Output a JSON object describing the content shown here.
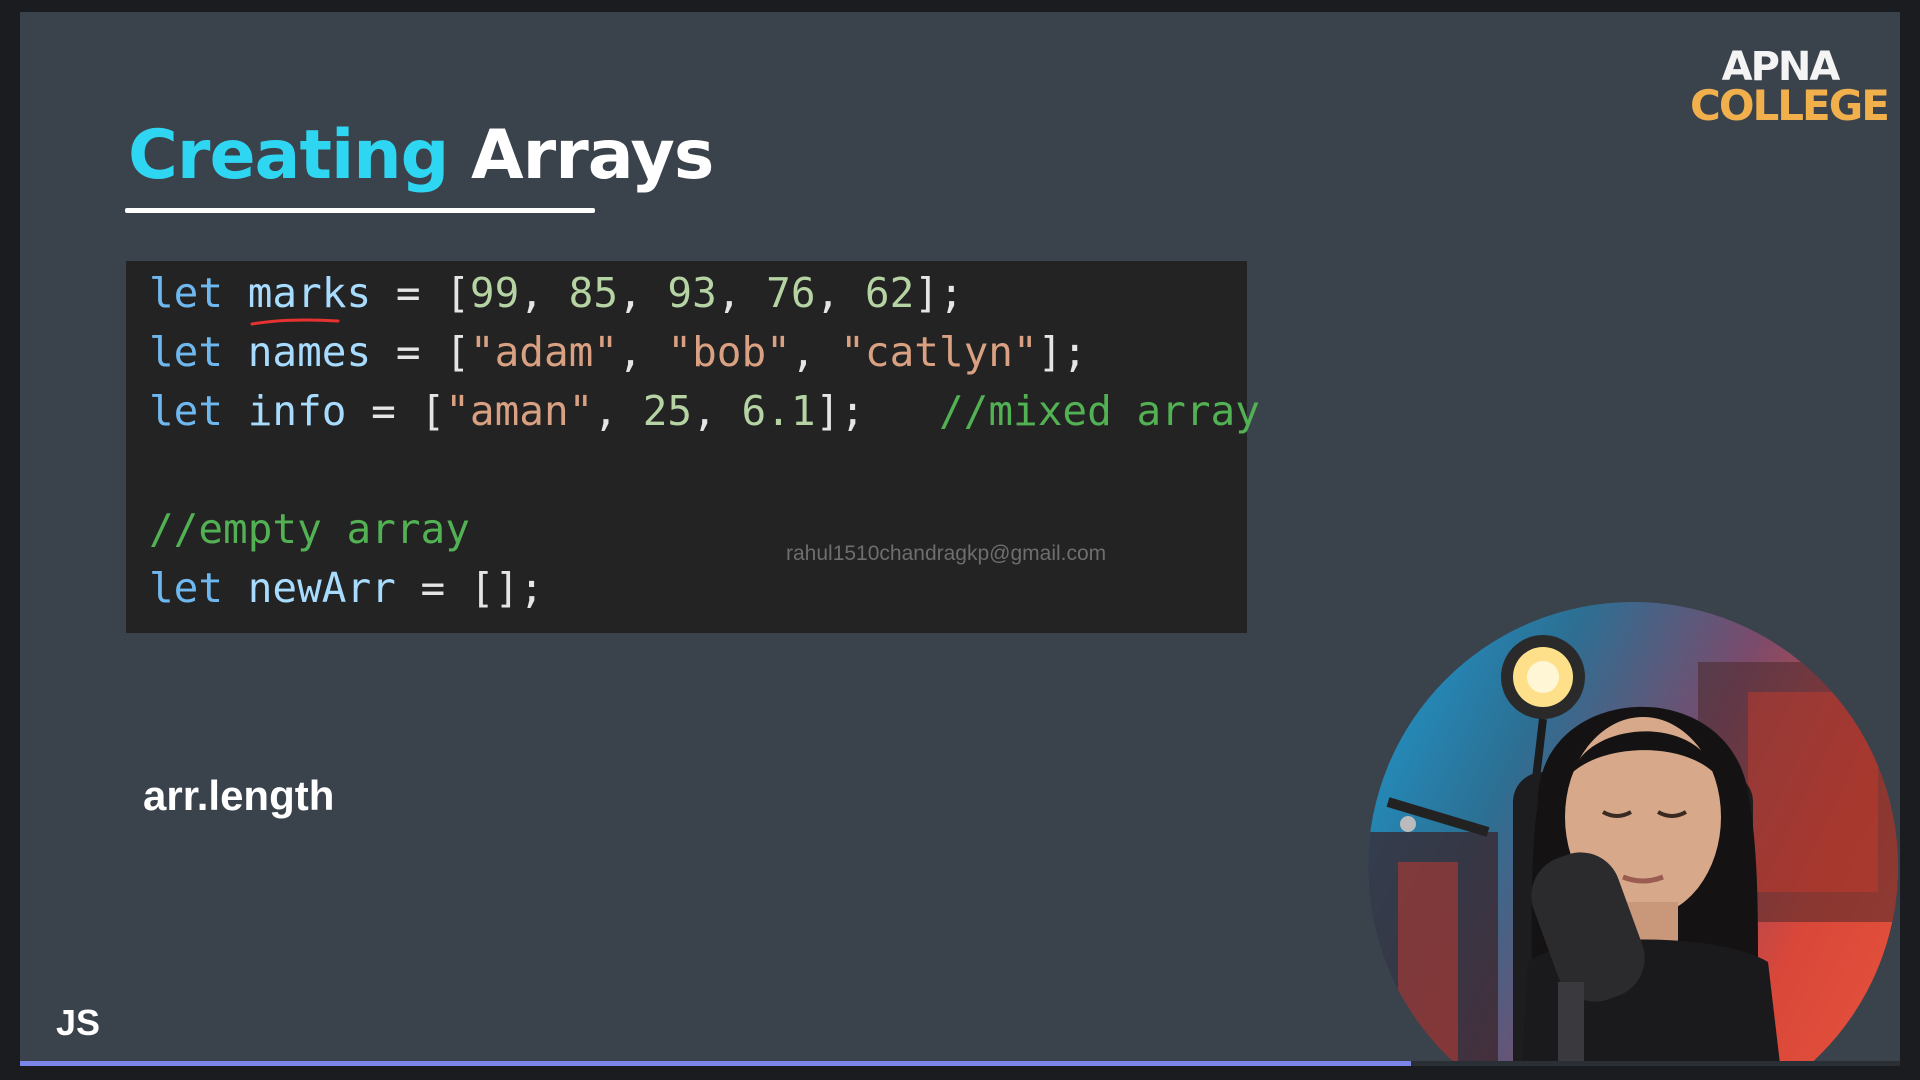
{
  "slide": {
    "title_part1": "Creating",
    "title_part2": "Arrays",
    "logo_line1": "APNA",
    "logo_line2": "COLLEGE",
    "code": {
      "line1": {
        "kw": "let",
        "var": "marks",
        "eq": " = [",
        "n1": "99",
        "n2": "85",
        "n3": "93",
        "n4": "76",
        "n5": "62",
        "end": "];"
      },
      "line2": {
        "kw": "let",
        "var": "names",
        "eq": " = [",
        "s1": "\"adam\"",
        "s2": "\"bob\"",
        "s3": "\"catlyn\"",
        "end": "];"
      },
      "line3": {
        "kw": "let",
        "var": "info",
        "eq": " = [",
        "s1": "\"aman\"",
        "n1": "25",
        "n2": "6.1",
        "end": "];",
        "comment": "//mixed array"
      },
      "line4_comment": "//empty array",
      "line5": {
        "kw": "let",
        "var": "newArr",
        "rest": " = [];"
      }
    },
    "watermark_email": "rahul1510chandragkp@gmail.com",
    "property_text": "arr.length",
    "corner_label": "JS"
  },
  "video": {
    "progress_fraction": 0.74
  },
  "colors": {
    "background": "#3a424c",
    "title_accent": "#2fd6f2",
    "logo_accent": "#f1b04c",
    "code_background": "#232324",
    "progress": "#7c86e8"
  }
}
